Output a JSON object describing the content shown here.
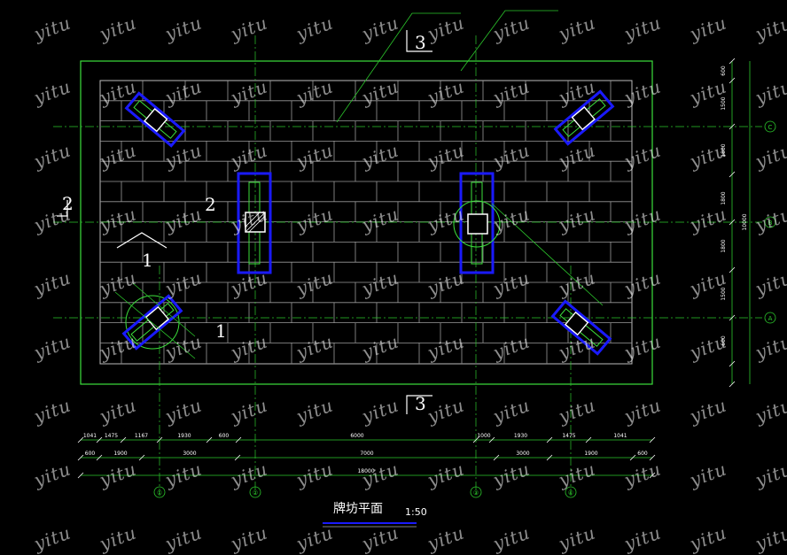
{
  "drawing": {
    "title": "牌坊平面",
    "scale": "1:50",
    "section_marks": {
      "top_3": "3",
      "bottom_3": "3",
      "left_2": "2",
      "mid_2": "2",
      "left_1a": "1",
      "left_1b": "1"
    },
    "axis_labels": {
      "bottom": [
        "①",
        "②",
        "③",
        "④"
      ],
      "right": [
        "A",
        "B",
        "C"
      ]
    },
    "dims_row1": [
      "1041",
      "1475",
      "1167",
      "1930",
      "600",
      "6000",
      "1000",
      "1930",
      "1475",
      "1041"
    ],
    "dims_row2": [
      "600",
      "1900",
      "3000",
      "7000",
      "3000",
      "1900",
      "600"
    ],
    "dim_total": "18000",
    "dims_right": [
      "600",
      "1500",
      "1800",
      "1800",
      "1800",
      "1500",
      "600"
    ],
    "dim_right_total": "10000"
  },
  "watermark": "yitu",
  "colors": {
    "outline": "#3ce03c",
    "brick": "#bdbdbd",
    "column": "#1a1aff",
    "dim": "#2cc82c",
    "text": "#ffffff"
  }
}
